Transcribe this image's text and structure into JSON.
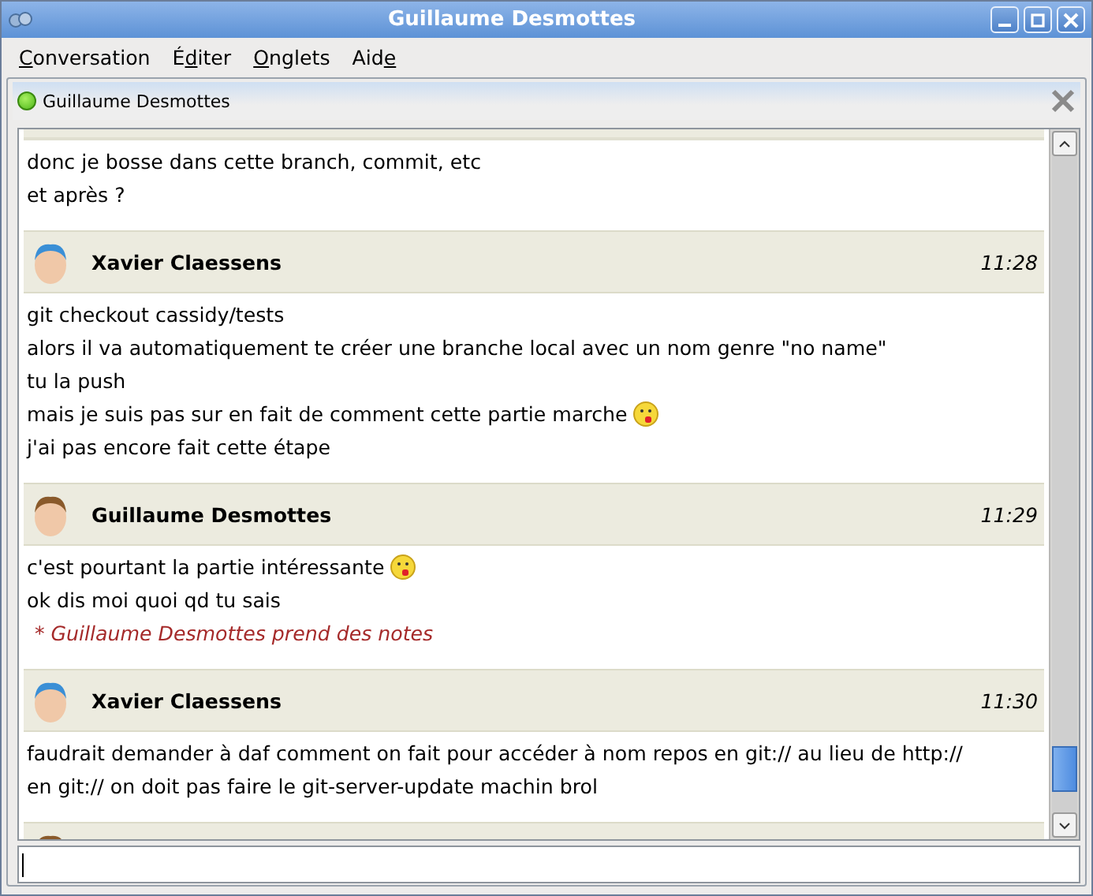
{
  "window": {
    "title": "Guillaume Desmottes"
  },
  "menu": [
    {
      "key": "C",
      "post": "onversation"
    },
    {
      "pre": "É",
      "key": "d",
      "post": "iter"
    },
    {
      "key": "O",
      "post": "nglets"
    },
    {
      "pre": "Aid",
      "key": "e"
    }
  ],
  "tab": {
    "label": "Guillaume Desmottes",
    "online": true
  },
  "log": [
    {
      "lines": [
        {
          "kind": "text",
          "text": "donc je bosse dans cette branch, commit, etc",
          "emoticon": false
        },
        {
          "kind": "text",
          "text": "et après ?",
          "emoticon": false
        }
      ]
    },
    {
      "header": {
        "avatar": {
          "color": "#3a8fd6"
        },
        "name": "Xavier Claessens",
        "time": "11:28"
      },
      "lines": [
        {
          "kind": "text",
          "text": "git checkout cassidy/tests",
          "emoticon": false
        },
        {
          "kind": "text",
          "text": "alors il va automatiquement te créer une branche local avec un nom genre \"no name\"",
          "emoticon": false
        },
        {
          "kind": "text",
          "text": "tu la push",
          "emoticon": false
        },
        {
          "kind": "text",
          "text": "mais je suis pas sur en fait de comment cette partie marche",
          "emoticon": true
        },
        {
          "kind": "text",
          "text": "j'ai pas encore fait cette étape",
          "emoticon": false
        }
      ]
    },
    {
      "header": {
        "avatar": {
          "color": "#8a5a2b"
        },
        "name": "Guillaume Desmottes",
        "time": "11:29"
      },
      "lines": [
        {
          "kind": "text",
          "text": "c'est pourtant la partie intéressante",
          "emoticon": true
        },
        {
          "kind": "text",
          "text": "ok dis moi quoi qd tu sais",
          "emoticon": false
        },
        {
          "kind": "action",
          "text": "* Guillaume Desmottes prend des notes",
          "emoticon": false
        }
      ]
    },
    {
      "header": {
        "avatar": {
          "color": "#3a8fd6"
        },
        "name": "Xavier Claessens",
        "time": "11:30"
      },
      "lines": [
        {
          "kind": "text",
          "text": "faudrait demander à daf comment on fait pour accéder à nom repos en git:// au lieu de http://",
          "emoticon": false
        },
        {
          "kind": "text",
          "text": "en git:// on doit pas faire le git-server-update machin brol",
          "emoticon": false
        }
      ]
    },
    {
      "header": {
        "avatar": {
          "color": "#8a5a2b"
        }
      }
    }
  ]
}
